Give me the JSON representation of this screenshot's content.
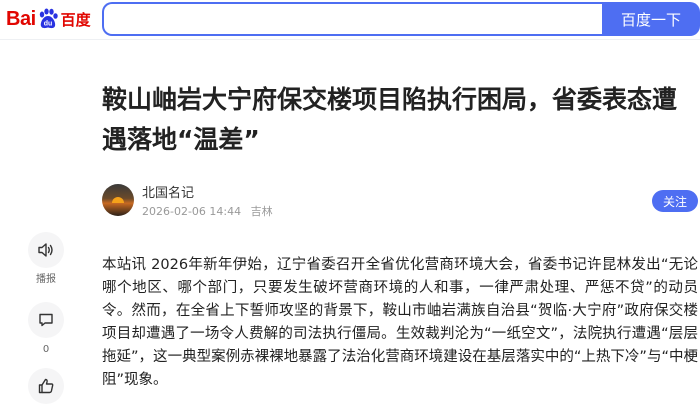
{
  "header": {
    "logo_bai": "Bai",
    "logo_du": "du",
    "logo_cn": "百度",
    "search_value": "",
    "search_button": "百度一下"
  },
  "article": {
    "title": "鞍山岫岩大宁府保交楼项目陷执行困局，省委表态遭遇落地“温差”",
    "author": "北国名记",
    "date": "2026-02-06 14:44",
    "location": "吉林",
    "follow_label": "关注",
    "body": "本站讯 2026年新年伊始，辽宁省委召开全省优化营商环境大会，省委书记许昆林发出“无论哪个地区、哪个部门，只要发生破坏营商环境的人和事，一律严肃处理、严惩不贷”的动员令。然而，在全省上下誓师攻坚的背景下，鞍山市岫岩满族自治县“贺临·大宁府”政府保交楼项目却遭遇了一场令人费解的司法执行僵局。生效裁判沦为“一纸空文”，法院执行遭遇“层层拖延”，这一典型案例赤裸裸地暴露了法治化营商环境建设在基层落实中的“上热下冷”与“中梗阻”现象。"
  },
  "rail": {
    "listen_label": "播报",
    "comment_count": "0"
  },
  "icons": {
    "listen": "speaker-icon",
    "comment": "comment-icon",
    "like": "thumbs-up-icon"
  },
  "colors": {
    "brand_blue": "#4e6ef2",
    "brand_red": "#e10601"
  }
}
